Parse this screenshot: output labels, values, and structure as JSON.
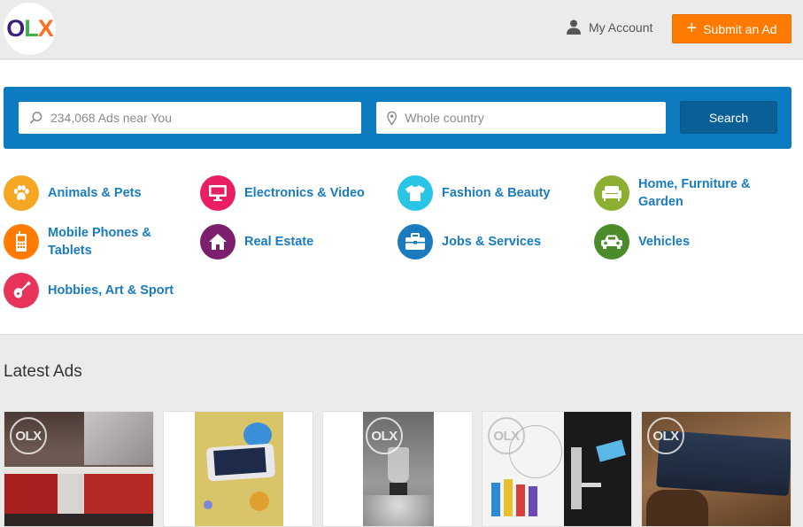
{
  "header": {
    "logo_letters": [
      "O",
      "L",
      "X"
    ],
    "logo_colors": [
      "#3a1f80",
      "#3ab54a",
      "#ff6e1f"
    ],
    "account_label": "My Account",
    "submit_label": "Submit an Ad"
  },
  "search": {
    "query_placeholder": "234,068 Ads near You",
    "location_placeholder": "Whole country",
    "button_label": "Search"
  },
  "categories": [
    {
      "label_lines": [
        "Animals & Pets"
      ],
      "icon": "paw-icon",
      "color": "#f5a623"
    },
    {
      "label_lines": [
        "Electronics & Video"
      ],
      "icon": "monitor-icon",
      "color": "#e91e63"
    },
    {
      "label_lines": [
        "Fashion & Beauty"
      ],
      "icon": "tshirt-icon",
      "color": "#29c5e6"
    },
    {
      "label_lines": [
        "Home, Furniture &",
        "Garden"
      ],
      "icon": "sofa-icon",
      "color": "#8bb031"
    },
    {
      "label_lines": [
        "Mobile Phones &",
        "Tablets"
      ],
      "icon": "phone-icon",
      "color": "#ff7a00"
    },
    {
      "label_lines": [
        "Real Estate"
      ],
      "icon": "house-icon",
      "color": "#7b1f6e"
    },
    {
      "label_lines": [
        "Jobs & Services"
      ],
      "icon": "briefcase-icon",
      "color": "#1a7bbf"
    },
    {
      "label_lines": [
        "Vehicles"
      ],
      "icon": "car-icon",
      "color": "#4a8c2a"
    },
    {
      "label_lines": [
        "Hobbies, Art & Sport"
      ],
      "icon": "guitar-icon",
      "color": "#e8345a"
    }
  ],
  "latest": {
    "title": "Latest Ads",
    "watermark": "OLX",
    "ads": [
      {
        "subject": "tv-cabinet"
      },
      {
        "subject": "smartphone"
      },
      {
        "subject": "blender"
      },
      {
        "subject": "hotel-lock-system"
      },
      {
        "subject": "dark-phone"
      }
    ]
  }
}
